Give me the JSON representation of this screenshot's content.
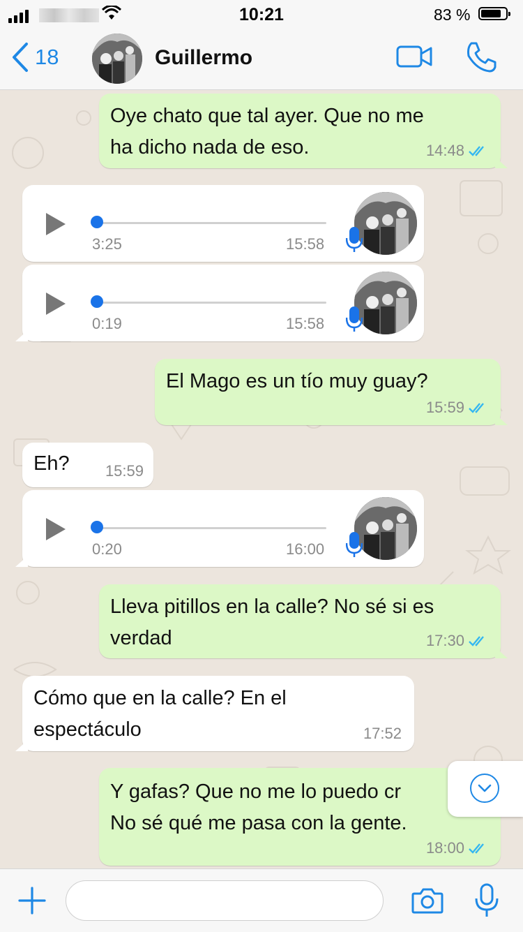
{
  "status": {
    "time": "10:21",
    "battery": "83 %"
  },
  "header": {
    "back_count": "18",
    "contact_name": "Guillermo"
  },
  "messages": [
    {
      "type": "text",
      "dir": "out",
      "text": [
        "Oye chato que tal ayer. Que no me",
        "ha dicho nada de eso."
      ],
      "time": "14:48",
      "read": true
    },
    {
      "type": "voice",
      "dir": "in",
      "duration": "3:25",
      "time": "15:58"
    },
    {
      "type": "voice",
      "dir": "in",
      "duration": "0:19",
      "time": "15:58"
    },
    {
      "type": "text",
      "dir": "out",
      "text": [
        "El Mago es un tío muy guay?"
      ],
      "time": "15:59",
      "read": true
    },
    {
      "type": "text",
      "dir": "in",
      "text": [
        "Eh?"
      ],
      "time": "15:59"
    },
    {
      "type": "voice",
      "dir": "in",
      "duration": "0:20",
      "time": "16:00"
    },
    {
      "type": "text",
      "dir": "out",
      "text": [
        "Lleva pitillos en la calle? No sé si es",
        "verdad"
      ],
      "time": "17:30",
      "read": true
    },
    {
      "type": "text",
      "dir": "in",
      "text": [
        "Cómo que en la calle? En el",
        "espectáculo"
      ],
      "time": "17:52"
    },
    {
      "type": "text",
      "dir": "out",
      "text": [
        "Y gafas? Que no me lo puedo cr",
        "No sé qué me pasa con la gente."
      ],
      "time": "18:00",
      "read": true
    }
  ],
  "input": {
    "placeholder": ""
  },
  "colors": {
    "accent": "#1e88e5",
    "outgoing": "#dcf8c6",
    "incoming": "#ffffff",
    "background": "#ece5dd",
    "read_ticks": "#34b7f1"
  }
}
